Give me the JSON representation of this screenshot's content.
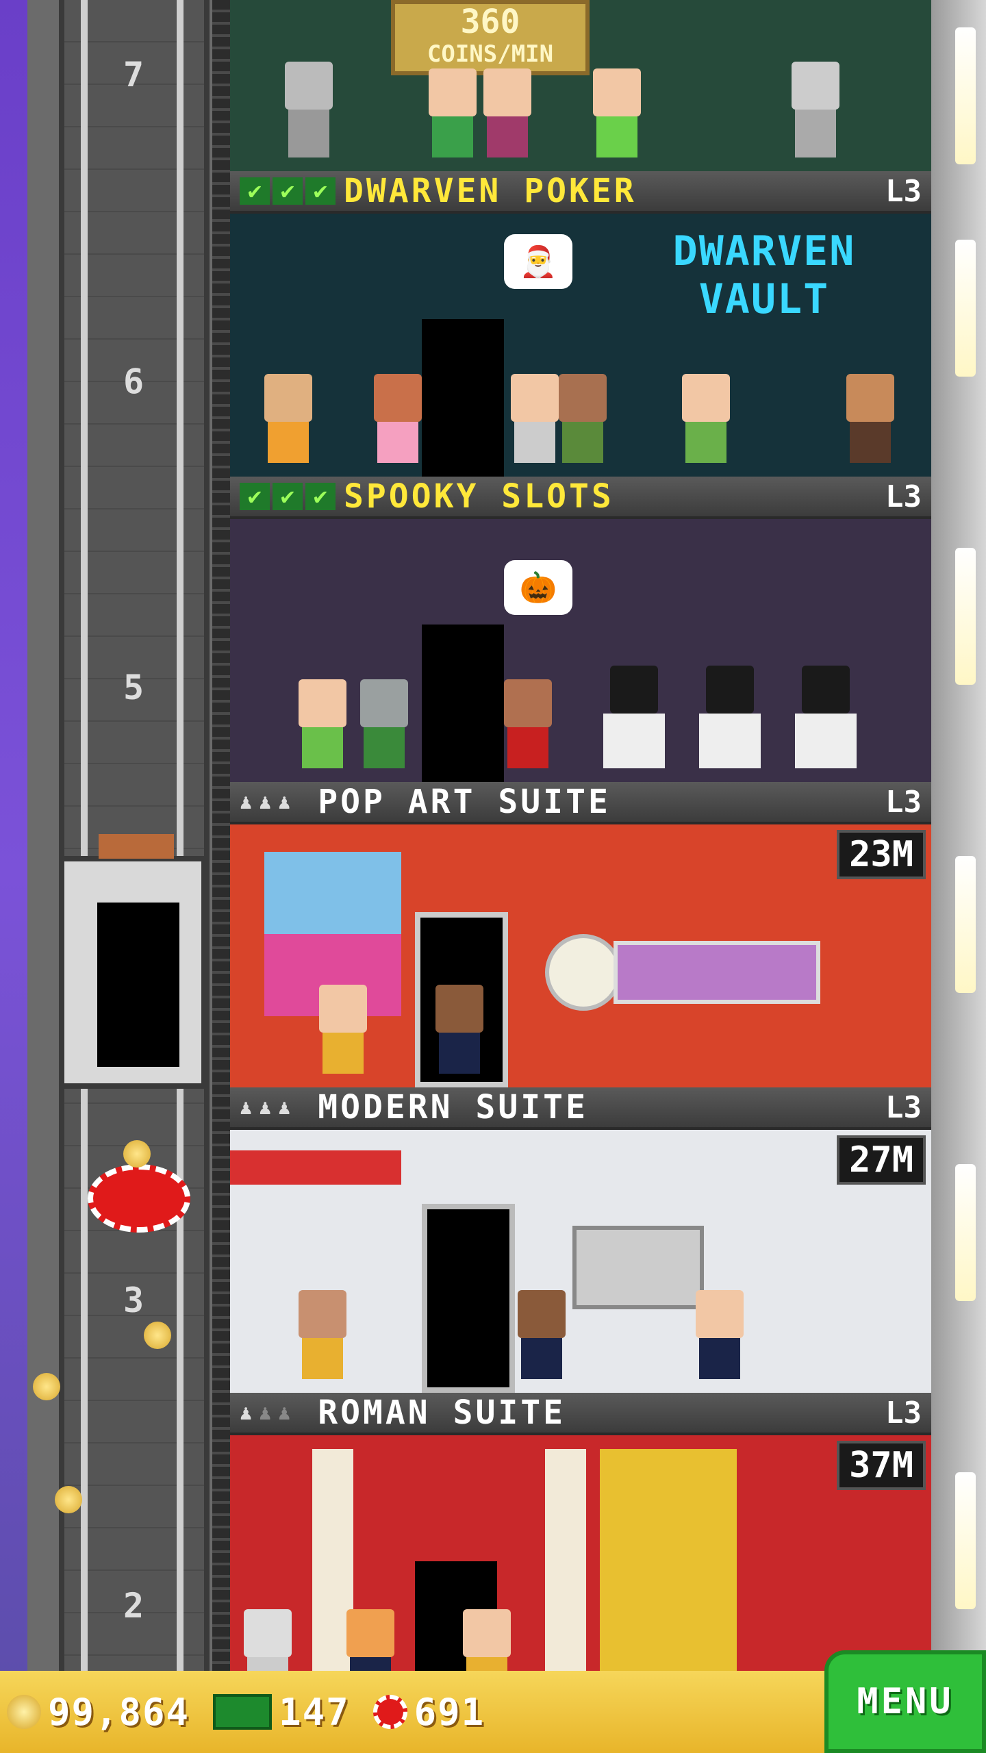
{
  "top_floor": {
    "rate_value": "360",
    "rate_unit": "COINS/MIN"
  },
  "floor_numbers": [
    "7",
    "6",
    "5",
    "3",
    "2"
  ],
  "floors": [
    {
      "name": "DWARVEN POKER",
      "level": "L3",
      "checks": 3,
      "sign": "DWARVEN VAULT",
      "bubble": "🎅"
    },
    {
      "name": "SPOOKY SLOTS",
      "level": "L3",
      "checks": 3,
      "bubble": "🎃"
    },
    {
      "name": "POP ART SUITE",
      "level": "L3",
      "price": "23M"
    },
    {
      "name": "MODERN SUITE",
      "level": "L3",
      "price": "27M"
    },
    {
      "name": "ROMAN SUITE",
      "level": "L3",
      "price": "37M"
    }
  ],
  "status_bar": {
    "coins": "99,864",
    "bux": "147",
    "chips": "691",
    "menu_label": "MENU"
  },
  "colors": {
    "accent_yellow": "#ffe83a",
    "menu_green": "#2fbf3a",
    "chip_red": "#e01a1a",
    "bux_green": "#1d8a2d"
  }
}
